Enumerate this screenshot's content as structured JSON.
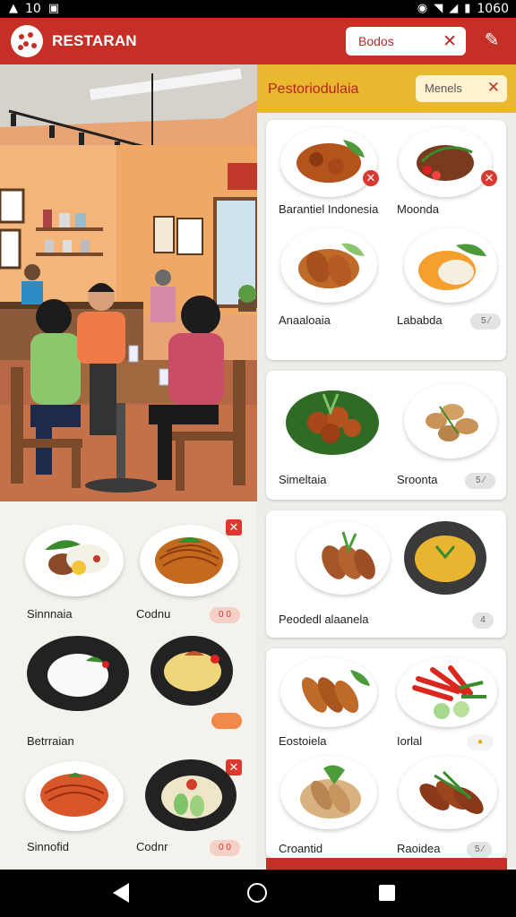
{
  "status_bar": {
    "left_glyph": "A",
    "time": "10",
    "battery": "1060",
    "icons": [
      "warning-icon",
      "notification-icon",
      "sync-icon",
      "wifi-icon",
      "signal-icon",
      "battery-icon"
    ]
  },
  "app_bar": {
    "title": "RESTARAN",
    "search_label": "Bodos",
    "icons": [
      "logo-icon",
      "close-icon",
      "edit-icon"
    ]
  },
  "right_header": {
    "title": "Pestoriodulaia",
    "menus_label": "Menels"
  },
  "left_grid": [
    {
      "label": "Sinnnaia",
      "badge": ""
    },
    {
      "label": "Codnu",
      "badge": "0 0"
    },
    {
      "label": "Betrraian",
      "badge": ""
    },
    {
      "label": "",
      "badge": ""
    },
    {
      "label": "Sinnofid",
      "badge": ""
    },
    {
      "label": "Codnr",
      "badge": "0 0"
    }
  ],
  "right_cards": [
    {
      "items": [
        {
          "label": "Barantiel Indonesia"
        },
        {
          "label": "Moonda"
        },
        {
          "label": "Anaaloaia"
        },
        {
          "label": "Lababda",
          "badge": "5 ⁄"
        }
      ]
    },
    {
      "items": [
        {
          "label": "Simeltaia"
        },
        {
          "label": "Sroonta",
          "badge": "5 ⁄"
        }
      ]
    },
    {
      "items": [
        {
          "label": "Peodedl alaanela",
          "badge": "4"
        }
      ]
    },
    {
      "items": [
        {
          "label": "Eostoiela"
        },
        {
          "label": "Iorlal"
        },
        {
          "label": "Croantid"
        },
        {
          "label": "Raoidea",
          "badge": "5 ⁄"
        }
      ]
    }
  ],
  "colors": {
    "brand_red": "#c62f26",
    "header_yellow": "#e9b82e",
    "background": "#f3f1ee"
  }
}
